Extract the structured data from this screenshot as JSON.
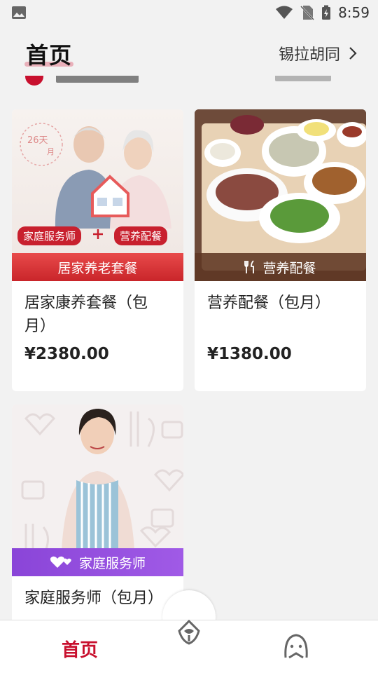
{
  "status": {
    "time": "8:59"
  },
  "header": {
    "title": "首页",
    "location": "锡拉胡同"
  },
  "products": [
    {
      "name": "居家康养套餐（包月）",
      "price": "¥2380.00",
      "banner": "居家养老套餐",
      "tags": [
        "家庭服务师",
        "营养配餐"
      ],
      "badge": "26天月"
    },
    {
      "name": "营养配餐（包月）",
      "price": "¥1380.00",
      "banner": "营养配餐"
    },
    {
      "name": "家庭服务师（包月）",
      "banner": "家庭服务师"
    }
  ],
  "nav": {
    "home": "首页"
  },
  "colors": {
    "accent": "#c8102e",
    "banner_red": "#d8333a",
    "banner_purple": "#9450e0",
    "banner_brown": "#5f3723"
  }
}
